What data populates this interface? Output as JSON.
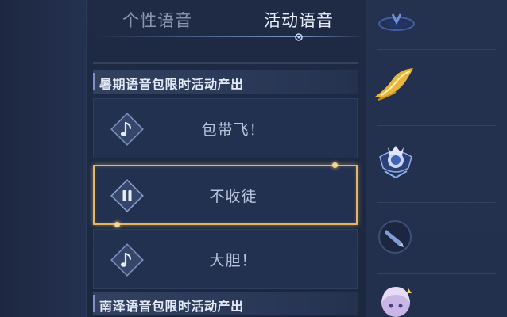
{
  "tabs": {
    "personal_label": "个性语音",
    "activity_label": "活动语音",
    "active": "活动语音"
  },
  "sections": [
    {
      "header": "暑期语音包限时活动产出",
      "items": [
        {
          "label": "包带飞！",
          "state": "idle",
          "icon": "music-note-icon"
        },
        {
          "label": "不收徒",
          "state": "playing",
          "icon": "pause-icon"
        },
        {
          "label": "大胆！",
          "state": "idle",
          "icon": "music-note-icon"
        }
      ]
    },
    {
      "header": "南泽语音包限时活动产出",
      "items": []
    }
  ],
  "right_column_icons": [
    "emblem-icon",
    "golden-wing-icon",
    "crown-badge-icon",
    "sword-token-icon",
    "hero-avatar-icon"
  ],
  "colors": {
    "background": "#23304c",
    "selected_border": "#e2b766",
    "active_tab_text": "#e8eefa",
    "inactive_tab_text": "#8a97b2"
  }
}
